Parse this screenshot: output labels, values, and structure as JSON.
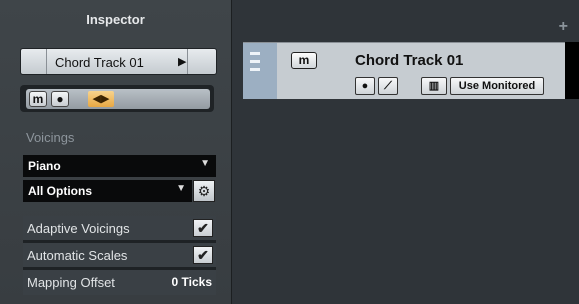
{
  "inspector": {
    "title": "Inspector",
    "track_name": "Chord Track 01",
    "mute_label": "m",
    "record_glyph": "●",
    "speaker_glyph": "◀▶",
    "voicings_label": "Voicings",
    "voicing_value": "Piano",
    "options_value": "All Options",
    "options": [
      {
        "label": "Adaptive Voicings",
        "checked": true
      },
      {
        "label": "Automatic Scales",
        "checked": true
      },
      {
        "label": "Mapping Offset",
        "value": "0 Ticks"
      }
    ]
  },
  "track": {
    "name": "Chord Track 01",
    "mute_label": "m",
    "record_glyph": "●",
    "monitor_label": "Use Monitored",
    "add_glyph": "+"
  },
  "colors": {
    "panel": "#3b4045",
    "track_color": "#9cafc2",
    "accent": "#e8a844"
  }
}
